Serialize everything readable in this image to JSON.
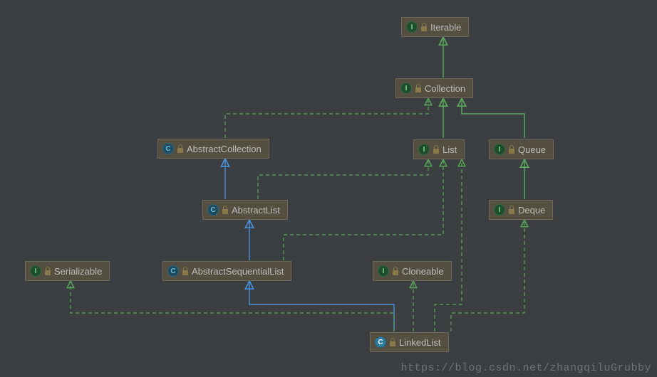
{
  "nodes": {
    "iterable": {
      "label": "Iterable",
      "kind": "interface"
    },
    "collection": {
      "label": "Collection",
      "kind": "interface"
    },
    "abscoll": {
      "label": "AbstractCollection",
      "kind": "class"
    },
    "list": {
      "label": "List",
      "kind": "interface"
    },
    "queue": {
      "label": "Queue",
      "kind": "interface"
    },
    "abslist": {
      "label": "AbstractList",
      "kind": "class"
    },
    "deque": {
      "label": "Deque",
      "kind": "interface"
    },
    "serializable": {
      "label": "Serializable",
      "kind": "interface"
    },
    "absseqlist": {
      "label": "AbstractSequentialList",
      "kind": "class"
    },
    "cloneable": {
      "label": "Cloneable",
      "kind": "interface"
    },
    "linkedlist": {
      "label": "LinkedList",
      "kind": "class-solid"
    }
  },
  "edges": [
    {
      "from": "collection",
      "to": "iterable",
      "style": "extends"
    },
    {
      "from": "abscoll",
      "to": "collection",
      "style": "implements"
    },
    {
      "from": "list",
      "to": "collection",
      "style": "extends-iface"
    },
    {
      "from": "queue",
      "to": "collection",
      "style": "extends-iface"
    },
    {
      "from": "abslist",
      "to": "abscoll",
      "style": "extends"
    },
    {
      "from": "abslist",
      "to": "list",
      "style": "implements"
    },
    {
      "from": "deque",
      "to": "queue",
      "style": "extends-iface"
    },
    {
      "from": "absseqlist",
      "to": "abslist",
      "style": "extends"
    },
    {
      "from": "absseqlist",
      "to": "list",
      "style": "implements"
    },
    {
      "from": "linkedlist",
      "to": "absseqlist",
      "style": "extends"
    },
    {
      "from": "linkedlist",
      "to": "serializable",
      "style": "implements"
    },
    {
      "from": "linkedlist",
      "to": "cloneable",
      "style": "implements"
    },
    {
      "from": "linkedlist",
      "to": "list",
      "style": "implements"
    },
    {
      "from": "linkedlist",
      "to": "deque",
      "style": "implements"
    }
  ],
  "watermark": "https://blog.csdn.net/zhangqiluGrubby",
  "colors": {
    "extends": "#4a90d9",
    "implements": "#5aa85a"
  }
}
